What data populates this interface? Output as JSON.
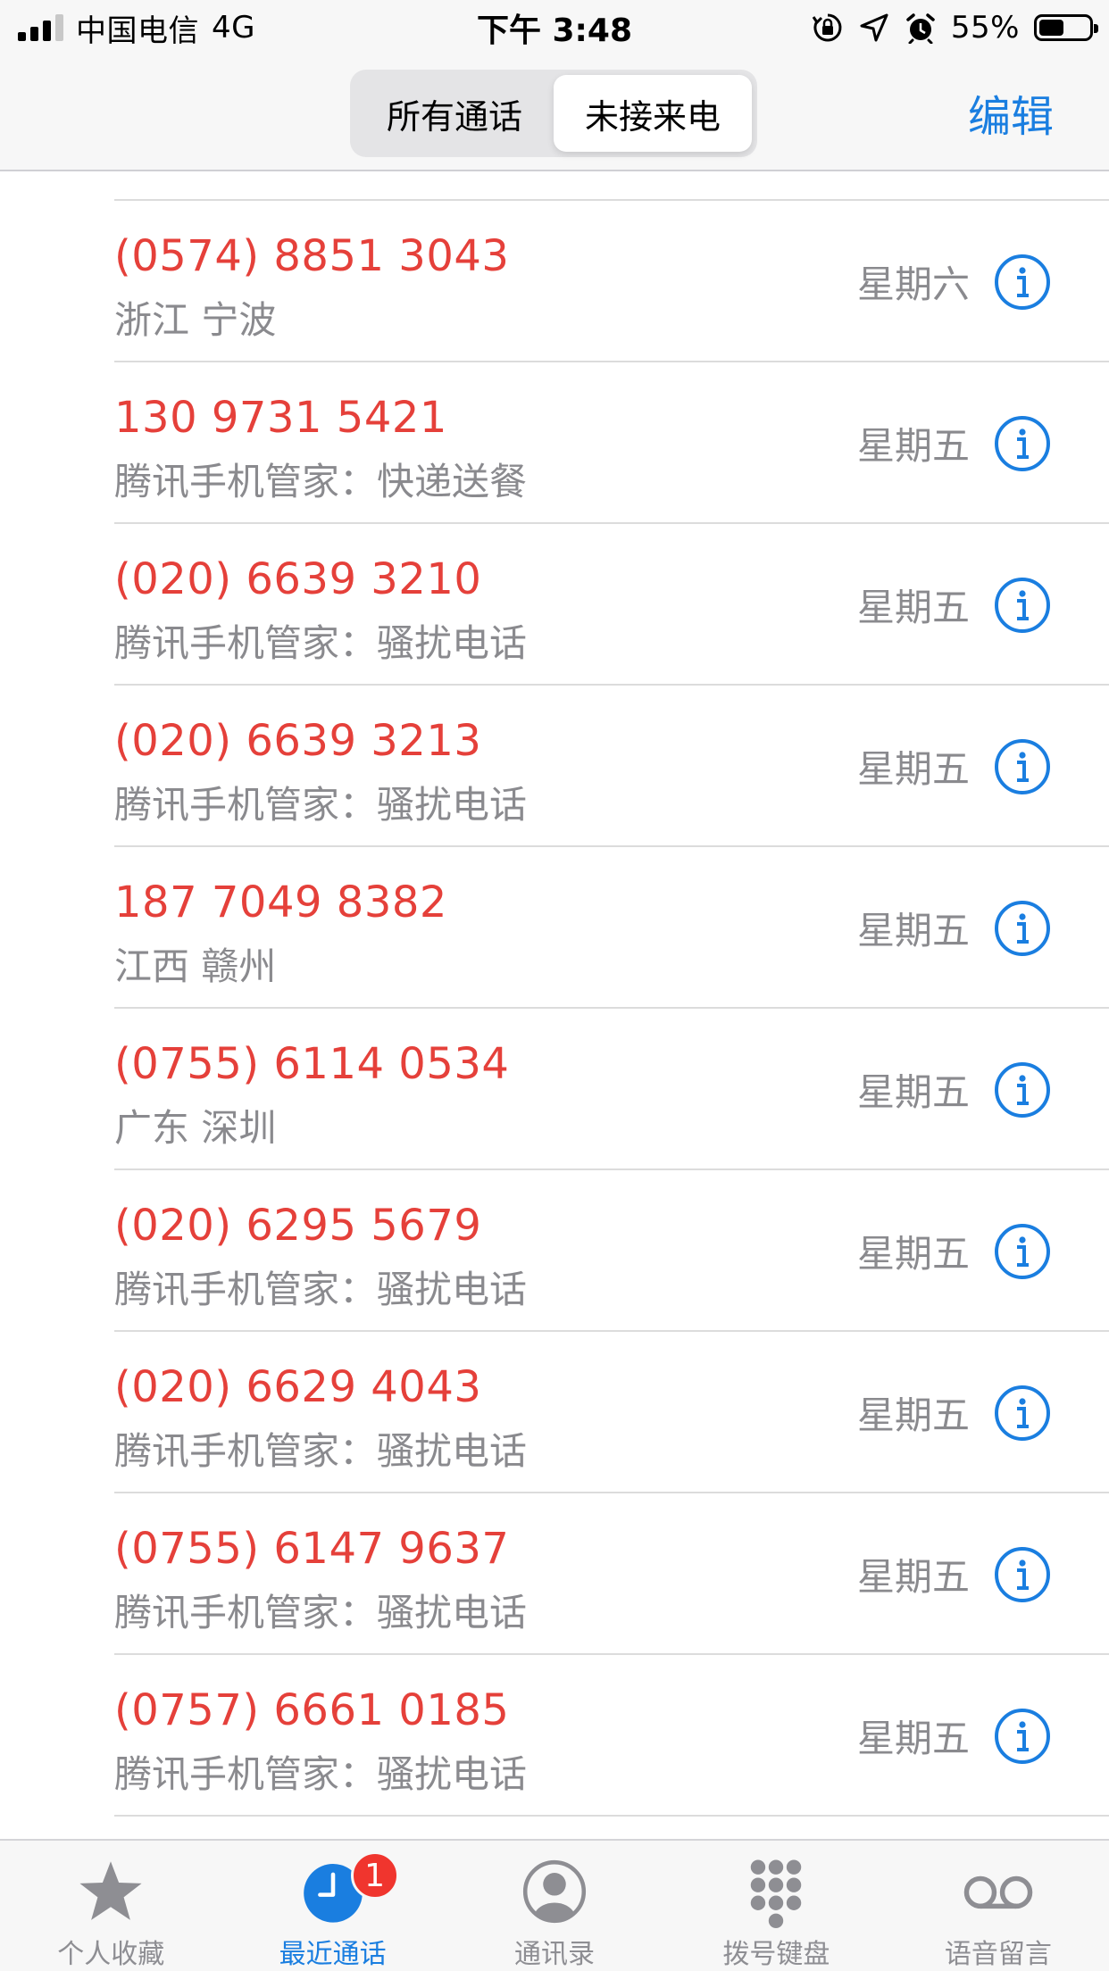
{
  "status_bar": {
    "carrier": "中国电信",
    "network": "4G",
    "time": "下午 3:48",
    "battery_percent": "55%",
    "battery_level": 0.55
  },
  "nav": {
    "segments": [
      "所有通话",
      "未接来电"
    ],
    "selected_segment": 1,
    "edit_label": "编辑"
  },
  "calls": [
    {
      "number": "(0574) 8851 3043",
      "location": "浙江 宁波",
      "day": "星期六"
    },
    {
      "number": "130 9731 5421",
      "location": "腾讯手机管家：快递送餐",
      "day": "星期五"
    },
    {
      "number": "(020) 6639 3210",
      "location": "腾讯手机管家：骚扰电话",
      "day": "星期五"
    },
    {
      "number": "(020) 6639 3213",
      "location": "腾讯手机管家：骚扰电话",
      "day": "星期五"
    },
    {
      "number": "187 7049 8382",
      "location": "江西 赣州",
      "day": "星期五"
    },
    {
      "number": "(0755) 6114 0534",
      "location": "广东 深圳",
      "day": "星期五"
    },
    {
      "number": "(020) 6295 5679",
      "location": "腾讯手机管家：骚扰电话",
      "day": "星期五"
    },
    {
      "number": "(020) 6629 4043",
      "location": "腾讯手机管家：骚扰电话",
      "day": "星期五"
    },
    {
      "number": "(0755) 6147 9637",
      "location": "腾讯手机管家：骚扰电话",
      "day": "星期五"
    },
    {
      "number": "(0757) 6661 0185",
      "location": "腾讯手机管家：骚扰电话",
      "day": "星期五"
    }
  ],
  "tabs": [
    {
      "label": "个人收藏",
      "icon": "star-icon"
    },
    {
      "label": "最近通话",
      "icon": "clock-icon",
      "active": true,
      "badge": "1"
    },
    {
      "label": "通讯录",
      "icon": "person-circle-icon"
    },
    {
      "label": "拨号键盘",
      "icon": "keypad-icon"
    },
    {
      "label": "语音留言",
      "icon": "voicemail-icon"
    }
  ],
  "colors": {
    "accent": "#1a7ee0",
    "missed": "#e5403a",
    "secondary_text": "#8a8a8e",
    "badge": "#f0352e"
  }
}
